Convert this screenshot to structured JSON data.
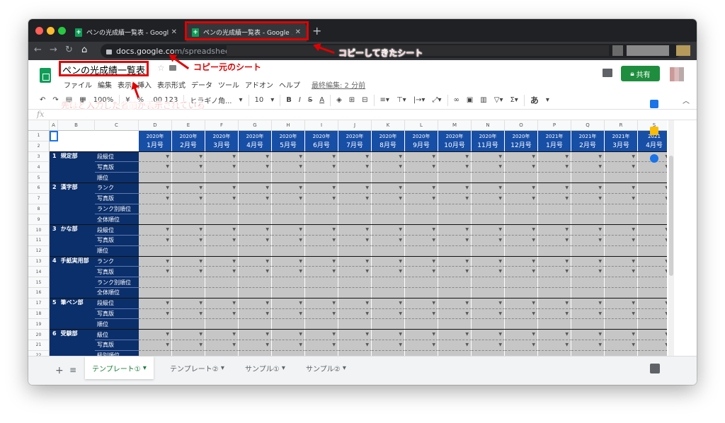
{
  "browser": {
    "tabs": [
      {
        "title": "ペンの光成績一覧表 - Google ス"
      },
      {
        "title": "ペンの光成績一覧表 - Google ス"
      }
    ],
    "new_tab": "+",
    "url_host": "docs.google.co",
    "url_path": "m/spreadsheets/"
  },
  "doc": {
    "title": "ペンの光成績一覧表",
    "menus": [
      "ファイル",
      "編集",
      "表示",
      "挿入",
      "表示形式",
      "データ",
      "ツール",
      "アドオン",
      "ヘルプ"
    ],
    "last_edit": "最終編集: 2 分前",
    "share_label": "共有"
  },
  "toolbar": {
    "font": "ヒラギノ角...",
    "font_size": "10",
    "bold": "B",
    "italic": "I",
    "strike": "S",
    "text_color": "A",
    "input_tools": "あ",
    "zoom": "100%",
    "number_format": ".00 123"
  },
  "formula": {
    "fx": "fx"
  },
  "grid": {
    "columns": [
      "A",
      "B",
      "C",
      "D",
      "E",
      "F",
      "G",
      "H",
      "I",
      "J",
      "K",
      "L",
      "M",
      "N",
      "O",
      "P",
      "Q",
      "R",
      "S"
    ],
    "rows": [
      "1",
      "2",
      "3",
      "4",
      "5",
      "6",
      "7",
      "8",
      "9",
      "10",
      "11",
      "12",
      "13",
      "14",
      "15",
      "16",
      "17",
      "18",
      "19",
      "20",
      "21",
      "22"
    ],
    "months": [
      {
        "year": "2020年",
        "month": "1月号"
      },
      {
        "year": "2020年",
        "month": "2月号"
      },
      {
        "year": "2020年",
        "month": "3月号"
      },
      {
        "year": "2020年",
        "month": "4月号"
      },
      {
        "year": "2020年",
        "month": "5月号"
      },
      {
        "year": "2020年",
        "month": "6月号"
      },
      {
        "year": "2020年",
        "month": "7月号"
      },
      {
        "year": "2020年",
        "month": "8月号"
      },
      {
        "year": "2020年",
        "month": "9月号"
      },
      {
        "year": "2020年",
        "month": "10月号"
      },
      {
        "year": "2020年",
        "month": "11月号"
      },
      {
        "year": "2020年",
        "month": "12月号"
      },
      {
        "year": "2021年",
        "month": "1月号"
      },
      {
        "year": "2021年",
        "month": "2月号"
      },
      {
        "year": "2021年",
        "month": "3月号"
      },
      {
        "year": "2021",
        "month": "4月号"
      }
    ],
    "departments": [
      {
        "num": "1",
        "name": "規定部",
        "items": [
          "段級位",
          "写真版",
          "順位"
        ]
      },
      {
        "num": "2",
        "name": "漢字部",
        "items": [
          "ランク",
          "写真版",
          "ランク別順位",
          "全体順位"
        ]
      },
      {
        "num": "3",
        "name": "かな部",
        "items": [
          "段級位",
          "写真版",
          "順位"
        ]
      },
      {
        "num": "4",
        "name": "手紙実用部",
        "items": [
          "ランク",
          "写真版",
          "ランク別順位",
          "全体順位"
        ]
      },
      {
        "num": "5",
        "name": "筆ペン部",
        "items": [
          "段級位",
          "写真版",
          "順位"
        ]
      },
      {
        "num": "6",
        "name": "受験部",
        "items": [
          "級位",
          "写真版",
          "級別順位"
        ]
      }
    ]
  },
  "sheets": [
    "テンプレート①",
    "テンプレート②",
    "サンプル①",
    "サンプル②"
  ],
  "annotations": {
    "copied_sheet": "コピーしてきたシート",
    "source_sheet": "コピー元のシート",
    "name_shown": "先ほど入力した名前が表示されている"
  },
  "colors": {
    "accent_red": "#e00000",
    "header_navy": "#0b2f6b",
    "month_blue": "#174ea6",
    "share_green": "#1e8e3e"
  }
}
